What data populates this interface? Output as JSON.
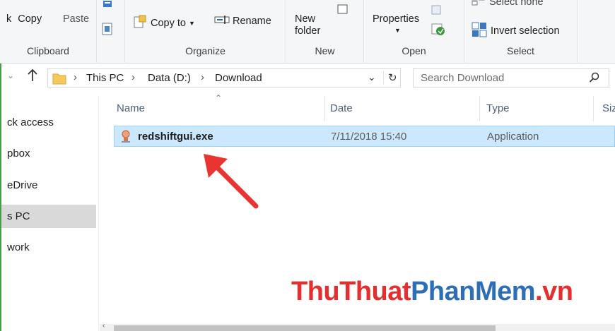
{
  "ribbon": {
    "clipboard": {
      "copy": "Copy",
      "paste": "Paste",
      "label": "Clipboard",
      "partial": "k"
    },
    "organize": {
      "copy_to": "Copy to",
      "rename": "Rename",
      "label": "Organize"
    },
    "new": {
      "new_folder_line1": "New",
      "new_folder_line2": "folder",
      "label": "New"
    },
    "open": {
      "properties": "Properties",
      "label": "Open"
    },
    "select": {
      "select_none": "Select none",
      "invert_selection": "Invert selection",
      "label": "Select"
    }
  },
  "address": {
    "crumbs": [
      "This PC",
      "Data (D:)",
      "Download"
    ],
    "search_placeholder": "Search Download"
  },
  "nav": {
    "items": [
      "ck access",
      "pbox",
      "eDrive",
      "s PC",
      "work"
    ]
  },
  "columns": {
    "name": "Name",
    "date": "Date",
    "type": "Type",
    "size": "Siz"
  },
  "file": {
    "name": "redshiftgui.exe",
    "date": "7/11/2018 15:40",
    "type": "Application"
  },
  "watermark": {
    "part1": "ThuThuat",
    "part2": "PhanMem",
    "part3": ".vn"
  },
  "colors": {
    "accent_red": "#e8352f",
    "selection": "#cce8ff",
    "watermark_blue": "#2c6fb7"
  }
}
